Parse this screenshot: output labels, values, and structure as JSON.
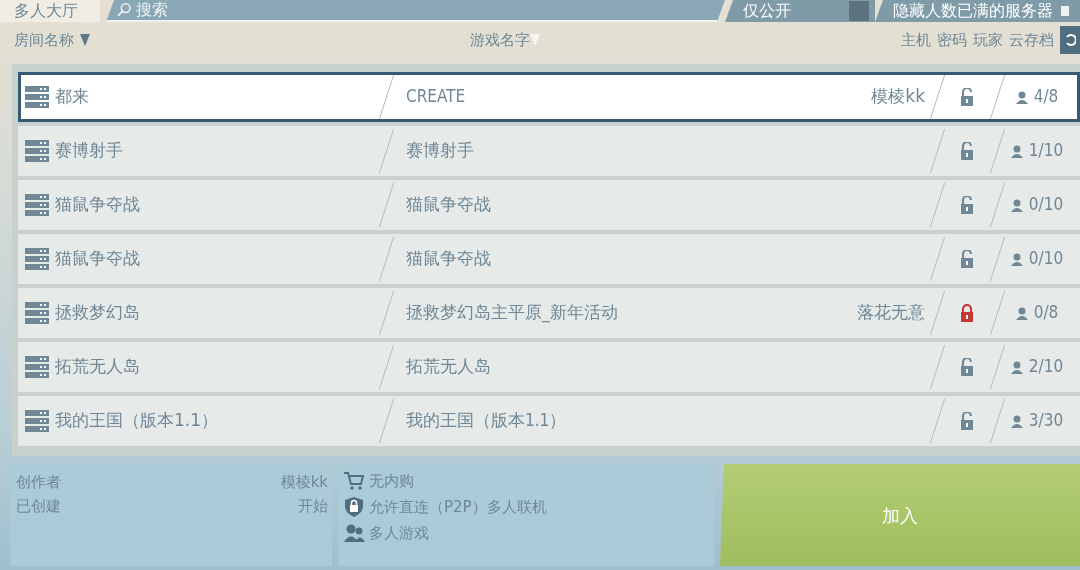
{
  "top_bar": {
    "lobby_tab": {
      "label": "多人大厅",
      "selected": true
    },
    "search": {
      "placeholder": "搜索"
    },
    "filters": [
      {
        "label": "仅公开",
        "checked": false
      },
      {
        "label": "隐藏人数已满的服务器",
        "checked": false
      }
    ]
  },
  "columns": {
    "room_name": "房间名称",
    "game_name": "游戏名字",
    "right": [
      "主机",
      "密码",
      "玩家",
      "云存档"
    ]
  },
  "rooms": [
    {
      "name": "都来",
      "game": "CREATE",
      "host": "模棱kk",
      "locked": false,
      "players": "4/8",
      "selected": true
    },
    {
      "name": "赛博射手",
      "game": "赛博射手",
      "locked": false,
      "players": "1/10",
      "selected": false
    },
    {
      "name": "猫鼠争夺战",
      "game": "猫鼠争夺战",
      "locked": false,
      "players": "0/10",
      "selected": false
    },
    {
      "name": "猫鼠争夺战",
      "game": "猫鼠争夺战",
      "locked": false,
      "players": "0/10",
      "selected": false
    },
    {
      "name": "拯救梦幻岛",
      "game": "拯救梦幻岛主平原_新年活动",
      "host": "落花无意",
      "locked": true,
      "players": "0/8",
      "selected": false
    },
    {
      "name": "拓荒无人岛",
      "game": "拓荒无人岛",
      "locked": false,
      "players": "2/10",
      "selected": false
    },
    {
      "name": "我的王国（版本1.1）",
      "game": "我的王国（版本1.1）",
      "locked": false,
      "players": "3/30",
      "selected": false
    }
  ],
  "details": {
    "info": [
      {
        "label": "创作者",
        "value": "模棱kk"
      },
      {
        "label": "已创建",
        "value": "开始"
      }
    ],
    "features": [
      {
        "kind": "cart",
        "text": "无内购"
      },
      {
        "kind": "shield",
        "text": "允许直连（P2P）多人联机"
      },
      {
        "kind": "people",
        "text": "多人游戏"
      }
    ],
    "join_button": "加入"
  }
}
